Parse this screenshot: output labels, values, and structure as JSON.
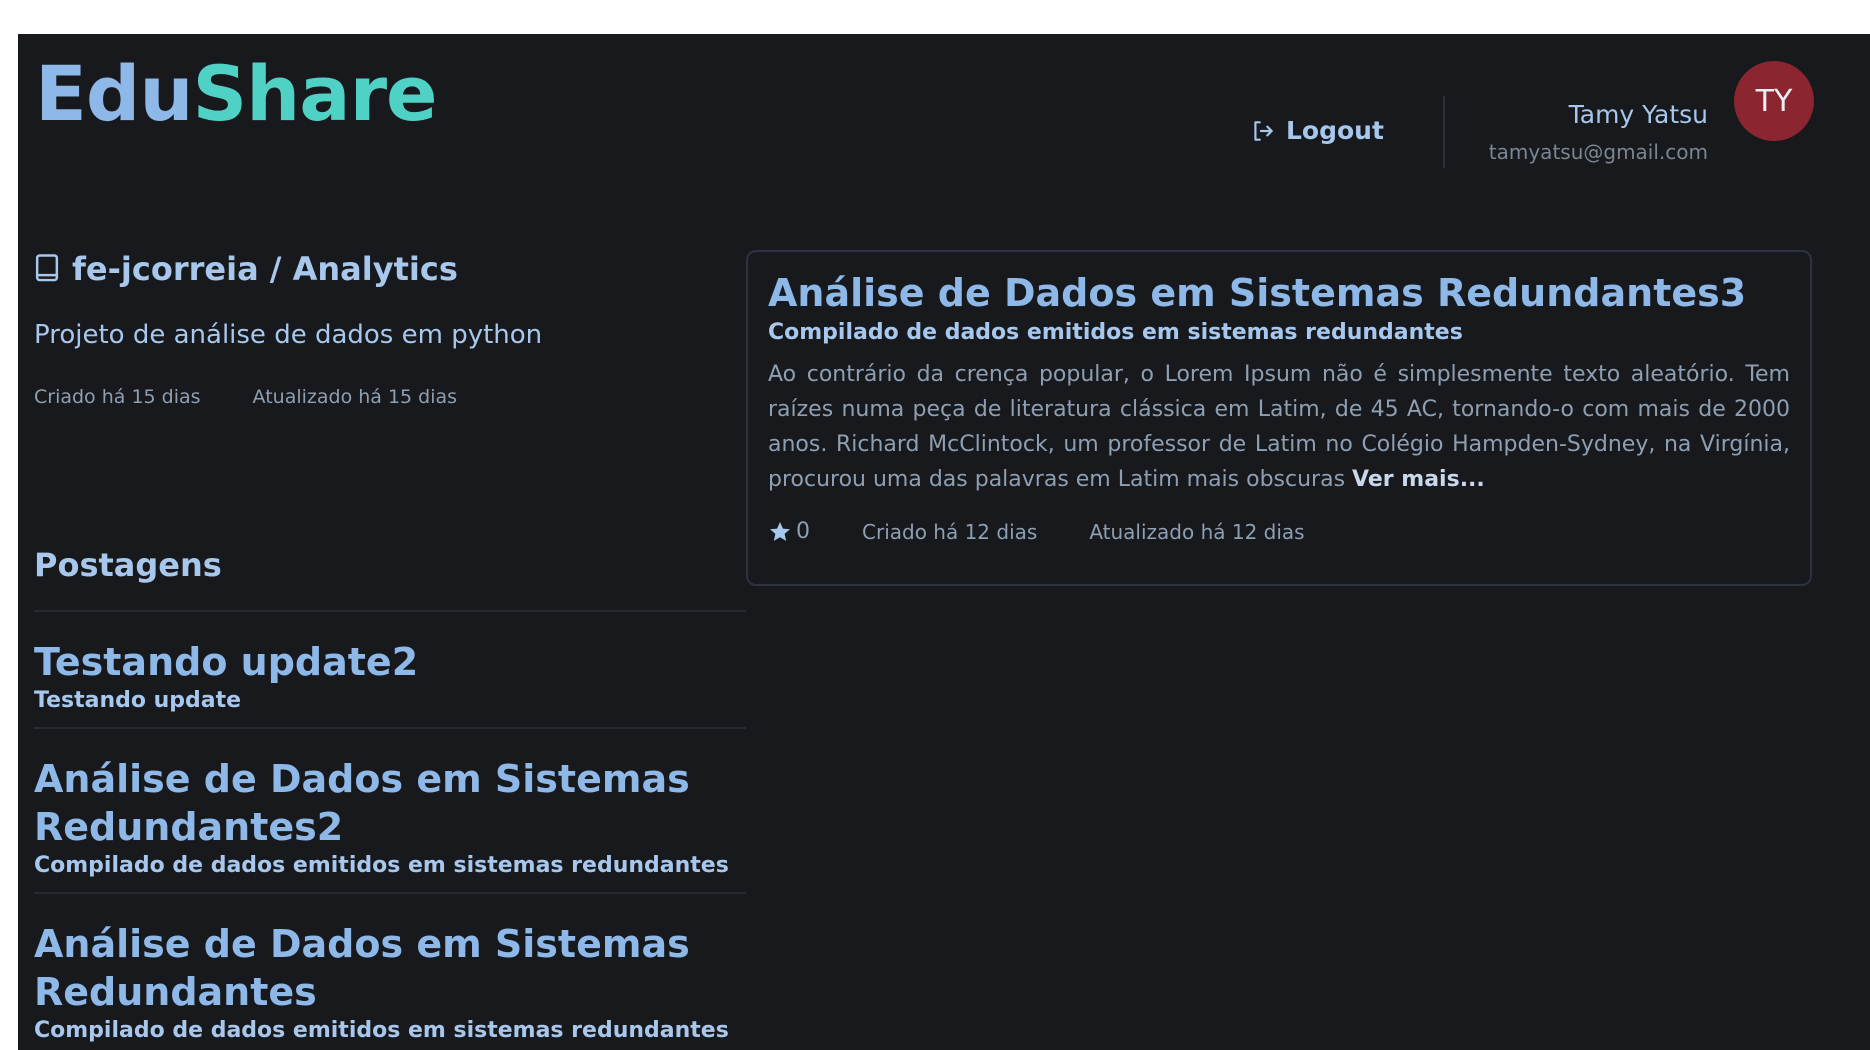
{
  "header": {
    "logo_part1": "Edu",
    "logo_part2": "Share",
    "logout_label": "Logout",
    "user_name": "Tamy Yatsu",
    "user_email": "tamyatsu@gmail.com",
    "avatar_initials": "TY"
  },
  "repo": {
    "name": "fe-jcorreia / Analytics",
    "description": "Projeto de análise de dados em python",
    "created": "Criado há 15 dias",
    "updated": "Atualizado há 15 dias"
  },
  "posts": {
    "section_title": "Postagens",
    "items": [
      {
        "title": "Testando update2",
        "subtitle": "Testando update"
      },
      {
        "title": "Análise de Dados em Sistemas Redundantes2",
        "subtitle": "Compilado de dados emitidos em sistemas redundantes"
      },
      {
        "title": "Análise de Dados em Sistemas Redundantes",
        "subtitle": "Compilado de dados emitidos em sistemas redundantes"
      }
    ]
  },
  "card": {
    "title": "Análise de Dados em Sistemas Redundantes3",
    "subtitle": "Compilado de dados emitidos em sistemas redundantes",
    "body": "Ao contrário da crença popular, o Lorem Ipsum não é simplesmente texto aleatório. Tem raízes numa peça de literatura clássica em Latim, de 45 AC, tornando-o com mais de 2000 anos. Richard McClintock, um professor de Latim no Colégio Hampden-Sydney, na Virgínia, procurou uma das palavras em Latim mais obscuras",
    "more_label": "Ver mais...",
    "stars": "0",
    "created": "Criado há 12 dias",
    "updated": "Atualizado há 12 dias"
  },
  "icons": {
    "logout": "logout-icon",
    "repo": "book-icon",
    "star": "star-icon"
  },
  "colors": {
    "background": "#17191d",
    "accent_blue": "#8db8e8",
    "accent_teal": "#4fd1c5",
    "avatar": "#8b2630"
  }
}
